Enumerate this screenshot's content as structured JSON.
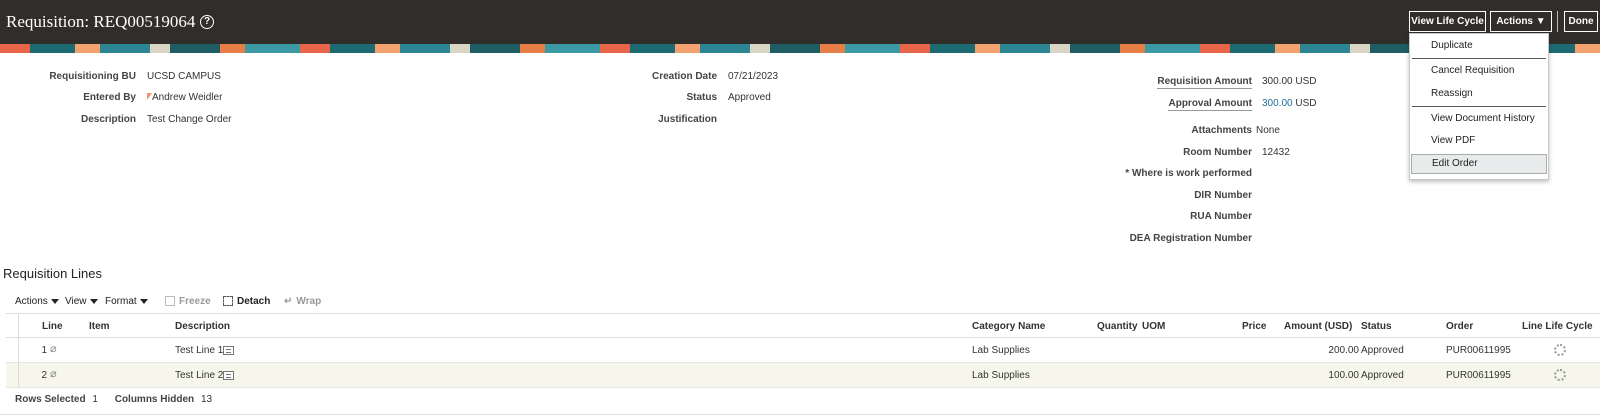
{
  "header": {
    "title": "Requisition: REQ00519064",
    "help_icon": "?",
    "view_life_cycle": "View Life Cycle",
    "actions": "Actions",
    "done": "Done"
  },
  "actions_menu": {
    "items": [
      "Duplicate",
      "Cancel Requisition",
      "Reassign",
      "View Document History",
      "View PDF",
      "Edit Order"
    ],
    "highlighted": "Edit Order"
  },
  "summary": {
    "requisitioning_bu_label": "Requisitioning BU",
    "requisitioning_bu": "UCSD CAMPUS",
    "entered_by_label": "Entered By",
    "entered_by": "Andrew Weidler",
    "description_label": "Description",
    "description": "Test Change Order",
    "creation_date_label": "Creation Date",
    "creation_date": "07/21/2023",
    "status_label": "Status",
    "status": "Approved",
    "justification_label": "Justification",
    "requisition_amount_label": "Requisition Amount",
    "requisition_amount": "300.00",
    "requisition_currency": "USD",
    "approval_amount_label": "Approval Amount",
    "approval_amount": "300.00",
    "approval_currency": "USD",
    "attachments_label": "Attachments",
    "attachments": "None",
    "room_number_label": "Room Number",
    "room_number": "12432",
    "work_performed_label": "* Where is work performed",
    "dir_number_label": "DIR Number",
    "rua_number_label": "RUA Number",
    "dea_number_label": "DEA Registration Number"
  },
  "lines_section": {
    "title": "Requisition Lines",
    "toolbar": {
      "actions": "Actions",
      "view": "View",
      "format": "Format",
      "freeze": "Freeze",
      "detach": "Detach",
      "wrap": "Wrap"
    },
    "columns": [
      "Line",
      "Item",
      "Description",
      "Category Name",
      "Quantity",
      "UOM",
      "Price",
      "Amount (USD)",
      "Status",
      "Order",
      "Line Life Cycle"
    ],
    "rows": [
      {
        "line": "1",
        "item": "",
        "description": "Test Line 1",
        "category": "Lab Supplies",
        "quantity": "",
        "uom": "",
        "price": "",
        "amount": "200.00",
        "status": "Approved",
        "order": "PUR00611995"
      },
      {
        "line": "2",
        "item": "",
        "description": "Test Line 2",
        "category": "Lab Supplies",
        "quantity": "",
        "uom": "",
        "price": "",
        "amount": "100.00",
        "status": "Approved",
        "order": "PUR00611995"
      }
    ],
    "footer": {
      "rows_selected_label": "Rows Selected",
      "rows_selected": "1",
      "columns_hidden_label": "Columns Hidden",
      "columns_hidden": "13"
    }
  },
  "colors": {
    "header_bg": "#312d2a",
    "link": "#1e6e9e",
    "selected_row": "#f6f7ea"
  }
}
